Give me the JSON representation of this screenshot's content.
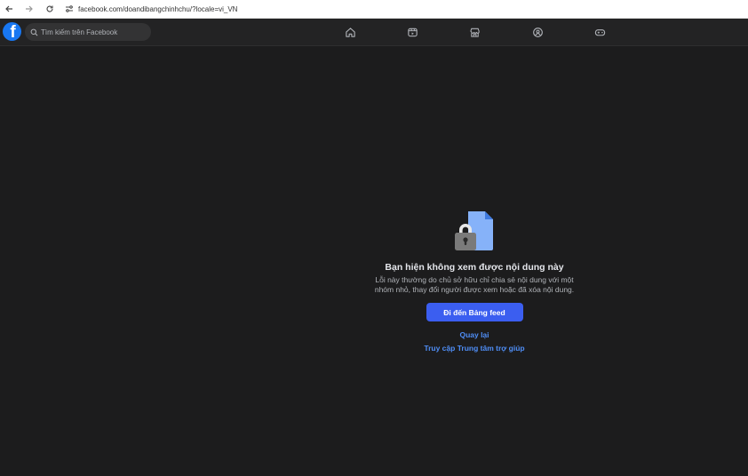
{
  "browser": {
    "url": "facebook.com/doandibangchinhchu/?locale=vi_VN"
  },
  "nav": {
    "logo_letter": "f",
    "search_placeholder": "Tìm kiếm trên Facebook",
    "tabs": [
      {
        "icon": "home-icon"
      },
      {
        "icon": "video-icon"
      },
      {
        "icon": "marketplace-icon"
      },
      {
        "icon": "groups-icon"
      },
      {
        "icon": "gaming-icon"
      }
    ]
  },
  "error": {
    "title": "Bạn hiện không xem được nội dung này",
    "description_line1": "Lỗi này thường do chủ sở hữu chỉ chia sẻ nội dung với một",
    "description_line2": "nhóm nhỏ, thay đổi người được xem hoặc đã xóa nội dung.",
    "primary_button": "Đi đến Bảng feed",
    "back_link": "Quay lại",
    "help_link": "Truy cập Trung tâm trợ giúp"
  },
  "colors": {
    "accent": "#3b5ef0",
    "link": "#4f8ef7",
    "background": "#1c1c1d",
    "brand": "#1877f2"
  }
}
